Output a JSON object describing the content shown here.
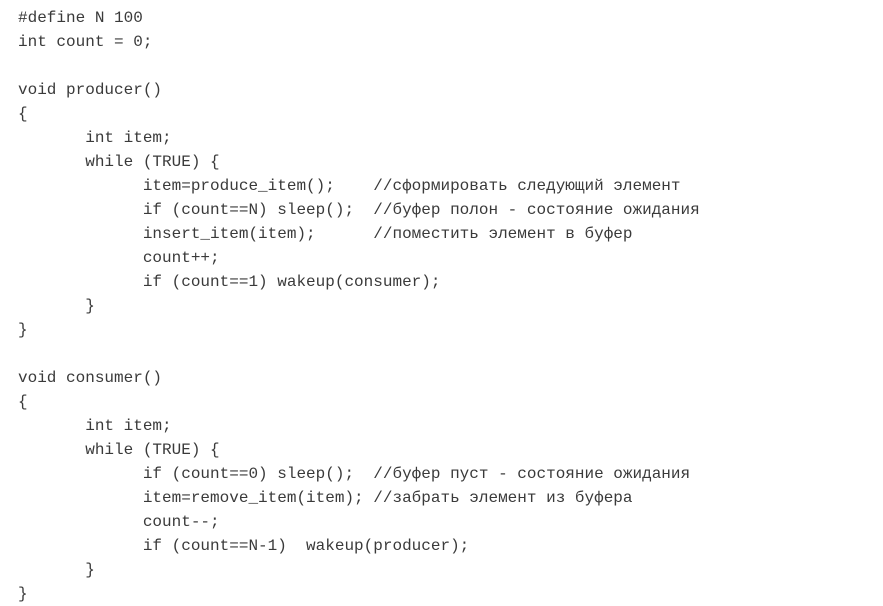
{
  "code": {
    "lines": [
      "#define N 100",
      "int count = 0;",
      "",
      "void producer()",
      "{",
      "       int item;",
      "       while (TRUE) {",
      "             item=produce_item();    //сформировать следующий элемент",
      "             if (count==N) sleep();  //буфер полон - состояние ожидания",
      "             insert_item(item);      //поместить элемент в буфер",
      "             count++;",
      "             if (count==1) wakeup(consumer);",
      "       }",
      "}",
      "",
      "void consumer()",
      "{",
      "       int item;",
      "       while (TRUE) {",
      "             if (count==0) sleep();  //буфер пуст - состояние ожидания",
      "             item=remove_item(item); //забрать элемент из буфера",
      "             count--;",
      "             if (count==N-1)  wakeup(producer);",
      "       }",
      "}"
    ]
  }
}
